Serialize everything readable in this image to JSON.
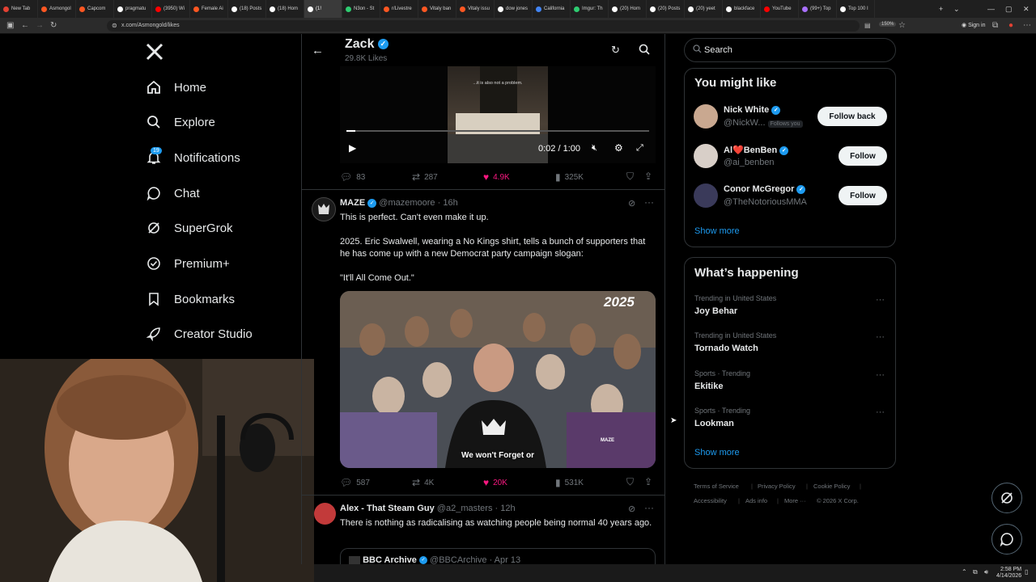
{
  "browser": {
    "tabs": [
      {
        "label": "New Tab",
        "color": "#e34133"
      },
      {
        "label": "Asmongol",
        "color": "#ff5722"
      },
      {
        "label": "Capcom",
        "color": "#ff5722"
      },
      {
        "label": "pragmatu",
        "color": "#ffffff"
      },
      {
        "label": "(3950) Wi",
        "color": "#ff0000"
      },
      {
        "label": "Female Ai",
        "color": "#ff5722"
      },
      {
        "label": "(18) Posts",
        "color": "#ffffff"
      },
      {
        "label": "(18) Hom",
        "color": "#ffffff"
      },
      {
        "label": "(1!",
        "color": "#ffffff",
        "active": true
      },
      {
        "label": "N3on - St",
        "color": "#2ecc71"
      },
      {
        "label": "r/Livestre",
        "color": "#ff5722"
      },
      {
        "label": "Vitaly ban",
        "color": "#ff5722"
      },
      {
        "label": "Vitaly issu",
        "color": "#ff5722"
      },
      {
        "label": "dow jones",
        "color": "#ffffff"
      },
      {
        "label": "California",
        "color": "#4285f4"
      },
      {
        "label": "Imgur: Th",
        "color": "#2ecc71"
      },
      {
        "label": "(20) Hom",
        "color": "#ffffff"
      },
      {
        "label": "(20) Posts",
        "color": "#ffffff"
      },
      {
        "label": "(20) yeet",
        "color": "#ffffff"
      },
      {
        "label": "blackface",
        "color": "#ffffff"
      },
      {
        "label": "YouTube",
        "color": "#ff0000"
      },
      {
        "label": "(99+) Top",
        "color": "#a970ff"
      },
      {
        "label": "Top 100 I",
        "color": "#ffffff"
      }
    ],
    "url": "x.com/Asmongold/likes",
    "zoom": "150%",
    "sign_in": "Sign in"
  },
  "nav": {
    "home": "Home",
    "explore": "Explore",
    "notifications": "Notifications",
    "notifications_badge": "19",
    "chat": "Chat",
    "supergrok": "SuperGrok",
    "premium": "Premium+",
    "bookmarks": "Bookmarks",
    "creator_studio": "Creator Studio"
  },
  "header": {
    "name": "Zack",
    "likes_count": "29.8K Likes"
  },
  "video_post": {
    "video_caption": "...it is also not a problem.",
    "time": "0:02 / 1:00",
    "progress": 0.03,
    "replies": "83",
    "reposts": "287",
    "likes": "4.9K",
    "views": "325K"
  },
  "tweet1": {
    "name": "MAZE",
    "handle": "@mazemoore",
    "time": "· 16h",
    "line1": "This is perfect. Can't even make it up.",
    "line2": "2025. Eric Swalwell, wearing a No Kings shirt, tells a bunch of supporters that he has come up with a new Democrat party campaign slogan:",
    "line3": "\"It'll All Come Out.\"",
    "image_year": "2025",
    "image_subtitle": "We won't Forget or",
    "shirt_text": "MAZE",
    "replies": "587",
    "reposts": "4K",
    "likes": "20K",
    "views": "531K"
  },
  "tweet2": {
    "name": "Alex - That Steam Guy",
    "handle": "@a2_masters",
    "time": "· 12h",
    "text": "There is nothing as radicalising as watching people being normal 40 years ago.",
    "quote_name": "BBC Archive",
    "quote_handle": "@BBCArchive",
    "quote_time": "· Apr 13"
  },
  "sidebar": {
    "search_placeholder": "Search",
    "you_might_like": "You might like",
    "suggestions": [
      {
        "name": "Nick White",
        "handle": "@NickW...",
        "follows_you": "Follows you",
        "button": "Follow back"
      },
      {
        "name": "Al❤️BenBen",
        "handle": "@ai_benben",
        "button": "Follow"
      },
      {
        "name": "Conor McGregor",
        "handle": "@TheNotoriousMMA",
        "button": "Follow"
      }
    ],
    "show_more": "Show more",
    "whats_happening": "What’s happening",
    "trends": [
      {
        "context": "Trending in United States",
        "name": "Joy Behar"
      },
      {
        "context": "Trending in United States",
        "name": "Tornado Watch"
      },
      {
        "context": "Sports · Trending",
        "name": "Ekitike"
      },
      {
        "context": "Sports · Trending",
        "name": "Lookman"
      }
    ],
    "show_more_2": "Show more",
    "footer": {
      "terms": "Terms of Service",
      "privacy": "Privacy Policy",
      "cookie": "Cookie Policy",
      "accessibility": "Accessibility",
      "ads": "Ads info",
      "more": "More ···",
      "copyright": "© 2026 X Corp."
    }
  },
  "taskbar": {
    "time": "2:58 PM",
    "date": "4/14/2026"
  },
  "colors": {
    "accent": "#1d9bf0",
    "like": "#f91880",
    "background": "#000000",
    "border": "#2f3336"
  }
}
